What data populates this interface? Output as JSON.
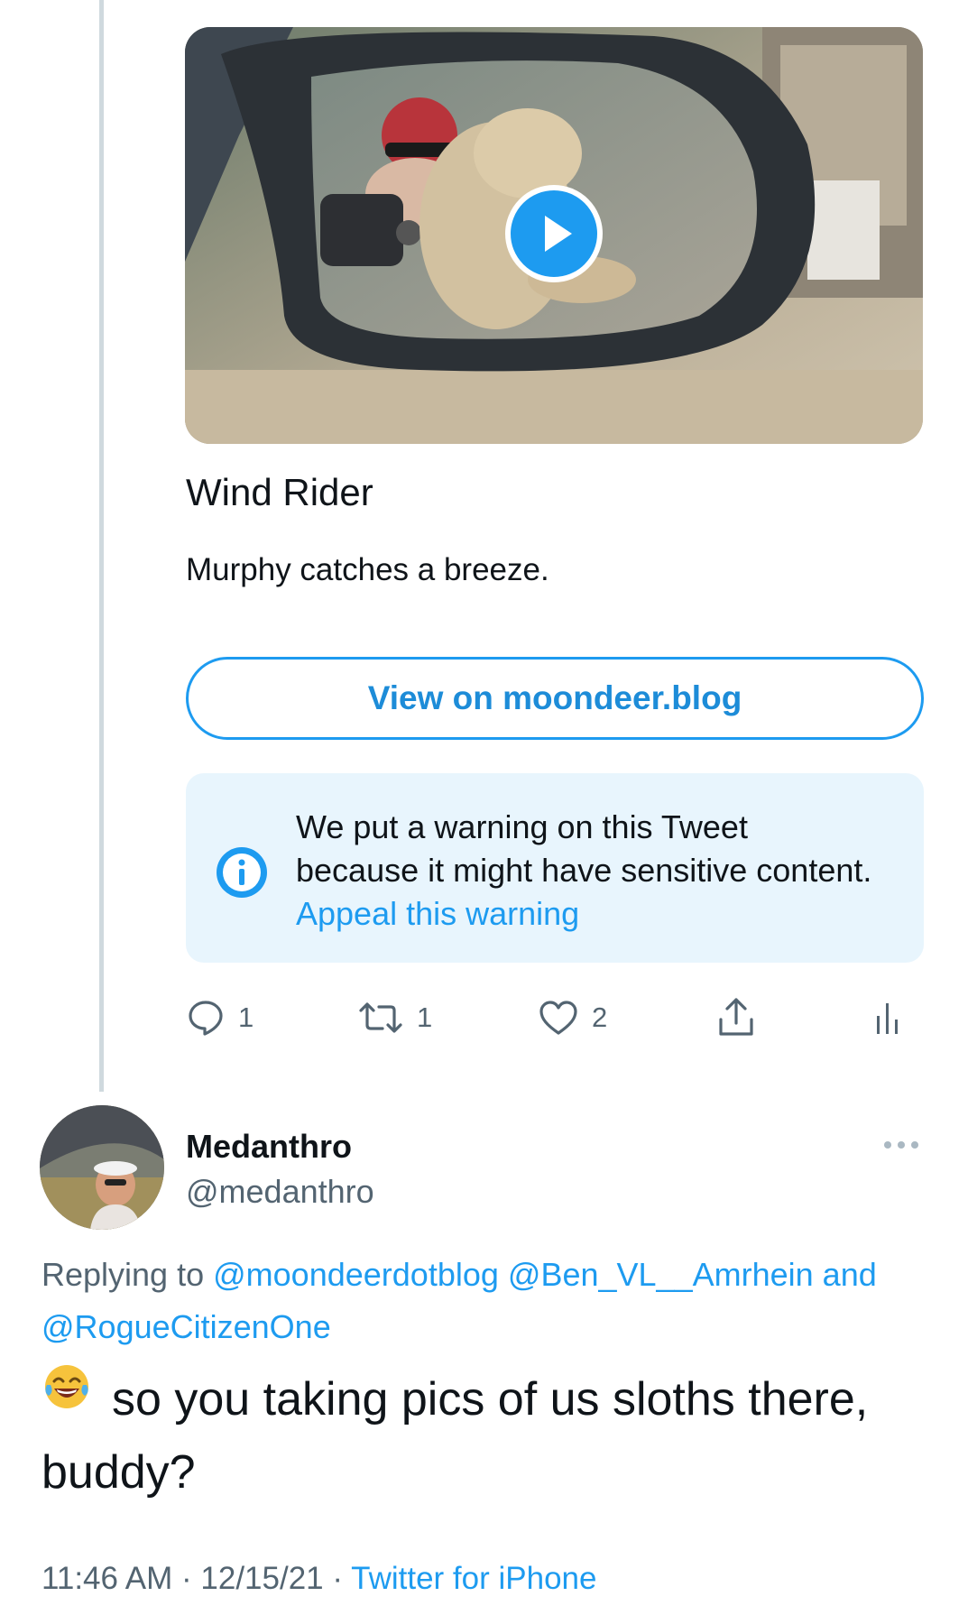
{
  "card": {
    "title": "Wind Rider",
    "description": "Murphy catches a breeze.",
    "view_button_label": "View on moondeer.blog"
  },
  "warning": {
    "text": "We put a warning on this Tweet because it might have sensitive content.",
    "link_label": "Appeal this warning"
  },
  "actions": {
    "replies": "1",
    "retweets": "1",
    "likes": "2"
  },
  "reply": {
    "display_name": "Medanthro",
    "handle": "@medanthro",
    "replying_prefix": "Replying to",
    "mention_1": "@moondeerdotblog",
    "mention_2": "@Ben_VL__Amrhein",
    "and_word": "and",
    "mention_3": "@RogueCitizenOne",
    "text": "so you taking pics of us sloths there, buddy?",
    "emoji": "😂",
    "time": "11:46 AM",
    "date": "12/15/21",
    "separator": "·",
    "source": "Twitter for iPhone"
  },
  "colors": {
    "accent": "#1d9bf0",
    "secondary_text": "#536471",
    "warning_background": "#e8f5fd"
  }
}
